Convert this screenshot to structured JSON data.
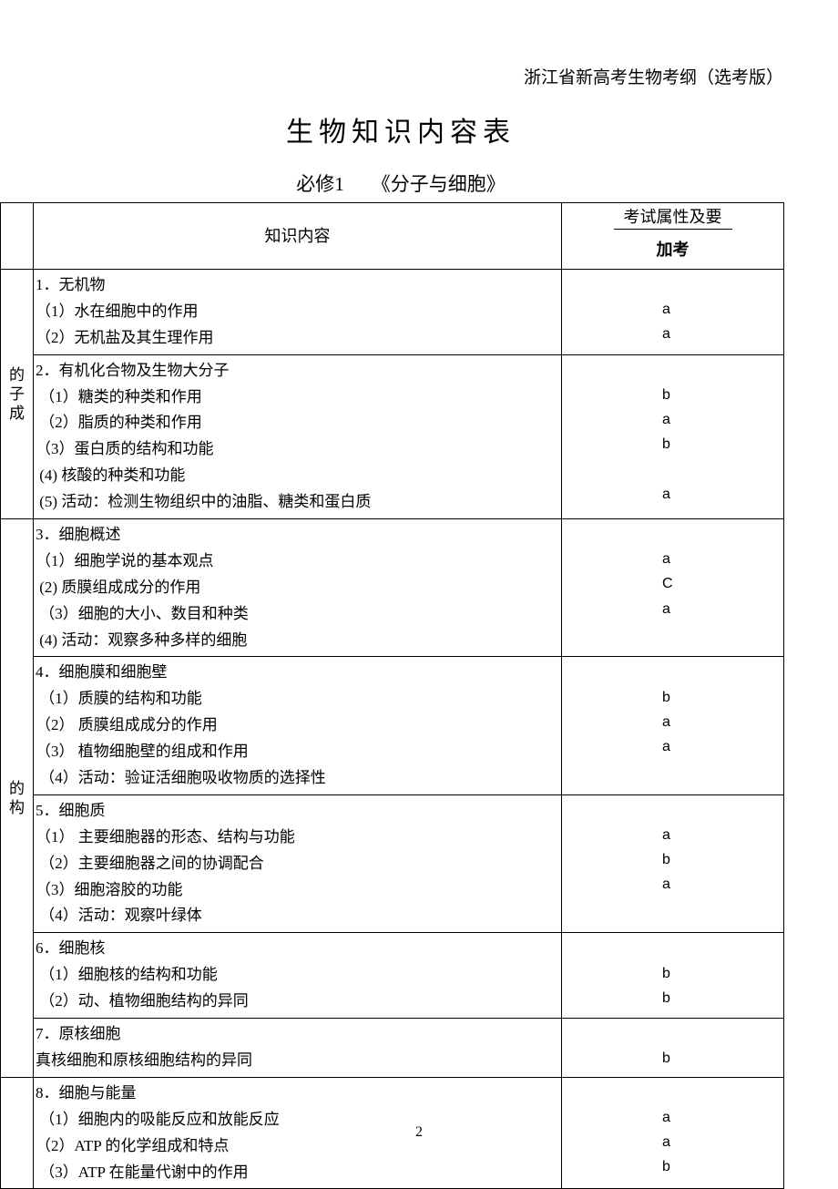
{
  "header_right": "浙江省新高考生物考纲（选考版）",
  "title_main": "生物知识内容表",
  "title_sub_left": "必修1",
  "title_sub_right": "《分子与细胞》",
  "headers": {
    "content": "知识内容",
    "exam_attr_line": "考试属性及要",
    "exam_sub": "加考"
  },
  "modules": [
    {
      "label": "的子成"
    },
    {
      "label": "的构"
    }
  ],
  "sections": [
    {
      "rows_content": [
        "1．无机物",
        "（1）水在细胞中的作用",
        "（2）无机盐及其生理作用"
      ],
      "rows_exam": [
        "",
        "a",
        "a"
      ],
      "module_index": 0,
      "module_start": false
    },
    {
      "rows_content": [
        "2．有机化合物及生物大分子",
        " （1）糖类的种类和作用",
        " （2）脂质的种类和作用",
        "（3）蛋白质的结构和功能",
        " (4) 核酸的种类和功能",
        " (5) 活动：检测生物组织中的油脂、糖类和蛋白质"
      ],
      "rows_exam": [
        "",
        "b",
        "a",
        "b",
        "",
        "a"
      ],
      "module_index": 0,
      "module_start": true
    },
    {
      "rows_content": [
        "3．细胞概述",
        "（1）细胞学说的基本观点",
        " (2) 质膜组成成分的作用",
        " （3）细胞的大小、数目和种类",
        " (4) 活动：观察多种多样的细胞"
      ],
      "rows_exam": [
        "",
        "a",
        "C",
        "a",
        ""
      ],
      "module_index": 1,
      "module_start": false
    },
    {
      "rows_content": [
        "4．细胞膜和细胞壁",
        " （1）质膜的结构和功能",
        "（2） 质膜组成成分的作用",
        "（3） 植物细胞壁的组成和作用",
        " （4）活动：验证活细胞吸收物质的选择性"
      ],
      "rows_exam": [
        "",
        "b",
        "a",
        "a",
        ""
      ],
      "module_index": 1,
      "module_start": true
    },
    {
      "rows_content": [
        "5．细胞质",
        "（1） 主要细胞器的形态、结构与功能",
        " （2）主要细胞器之间的协调配合",
        "（3）细胞溶胶的功能",
        " （4）活动：观察叶绿体"
      ],
      "rows_exam": [
        "",
        "a",
        "b",
        "a",
        ""
      ],
      "module_index": 1,
      "module_start": false
    },
    {
      "rows_content": [
        "6．细胞核",
        " （1）细胞核的结构和功能",
        " （2）动、植物细胞结构的异同"
      ],
      "rows_exam": [
        "",
        "b",
        "b"
      ],
      "module_index": 1,
      "module_start": false
    },
    {
      "rows_content": [
        "7．原核细胞",
        "真核细胞和原核细胞结构的异同"
      ],
      "rows_exam": [
        "",
        "b"
      ],
      "module_index": 1,
      "module_start": false
    },
    {
      "rows_content": [
        "8．细胞与能量",
        " （1）细胞内的吸能反应和放能反应",
        "（2）ATP 的化学组成和特点",
        " （3）ATP 在能量代谢中的作用"
      ],
      "rows_exam": [
        "",
        "a",
        "a",
        "b"
      ],
      "module_index": null,
      "module_start": false
    }
  ],
  "page_number": "2"
}
